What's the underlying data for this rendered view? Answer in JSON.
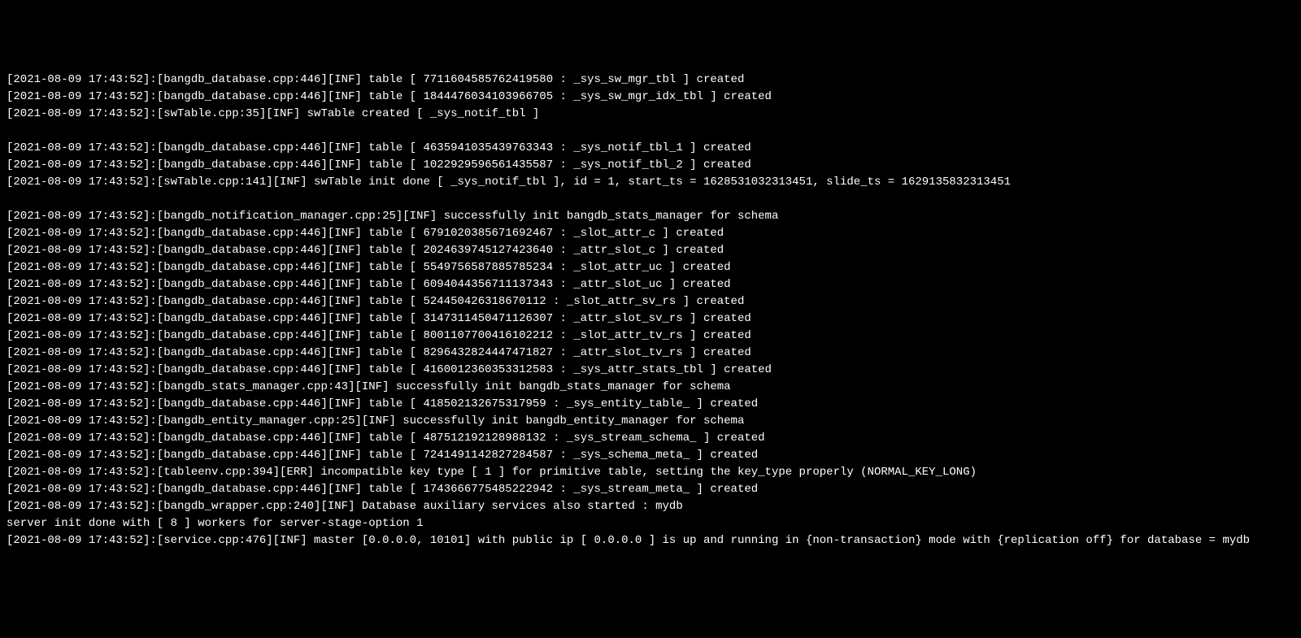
{
  "log_lines": [
    "[2021-08-09 17:43:52]:[bangdb_database.cpp:446][INF] table [ 7711604585762419580 : _sys_sw_mgr_tbl ] created",
    "[2021-08-09 17:43:52]:[bangdb_database.cpp:446][INF] table [ 1844476034103966705 : _sys_sw_mgr_idx_tbl ] created",
    "[2021-08-09 17:43:52]:[swTable.cpp:35][INF] swTable created [ _sys_notif_tbl ]",
    "",
    "[2021-08-09 17:43:52]:[bangdb_database.cpp:446][INF] table [ 4635941035439763343 : _sys_notif_tbl_1 ] created",
    "[2021-08-09 17:43:52]:[bangdb_database.cpp:446][INF] table [ 1022929596561435587 : _sys_notif_tbl_2 ] created",
    "[2021-08-09 17:43:52]:[swTable.cpp:141][INF] swTable init done [ _sys_notif_tbl ], id = 1, start_ts = 1628531032313451, slide_ts = 1629135832313451",
    "",
    "[2021-08-09 17:43:52]:[bangdb_notification_manager.cpp:25][INF] successfully init bangdb_stats_manager for schema",
    "[2021-08-09 17:43:52]:[bangdb_database.cpp:446][INF] table [ 6791020385671692467 : _slot_attr_c ] created",
    "[2021-08-09 17:43:52]:[bangdb_database.cpp:446][INF] table [ 2024639745127423640 : _attr_slot_c ] created",
    "[2021-08-09 17:43:52]:[bangdb_database.cpp:446][INF] table [ 5549756587885785234 : _slot_attr_uc ] created",
    "[2021-08-09 17:43:52]:[bangdb_database.cpp:446][INF] table [ 6094044356711137343 : _attr_slot_uc ] created",
    "[2021-08-09 17:43:52]:[bangdb_database.cpp:446][INF] table [ 524450426318670112 : _slot_attr_sv_rs ] created",
    "[2021-08-09 17:43:52]:[bangdb_database.cpp:446][INF] table [ 3147311450471126307 : _attr_slot_sv_rs ] created",
    "[2021-08-09 17:43:52]:[bangdb_database.cpp:446][INF] table [ 8001107700416102212 : _slot_attr_tv_rs ] created",
    "[2021-08-09 17:43:52]:[bangdb_database.cpp:446][INF] table [ 8296432824447471827 : _attr_slot_tv_rs ] created",
    "[2021-08-09 17:43:52]:[bangdb_database.cpp:446][INF] table [ 4160012360353312583 : _sys_attr_stats_tbl ] created",
    "[2021-08-09 17:43:52]:[bangdb_stats_manager.cpp:43][INF] successfully init bangdb_stats_manager for schema",
    "[2021-08-09 17:43:52]:[bangdb_database.cpp:446][INF] table [ 418502132675317959 : _sys_entity_table_ ] created",
    "[2021-08-09 17:43:52]:[bangdb_entity_manager.cpp:25][INF] successfully init bangdb_entity_manager for schema",
    "[2021-08-09 17:43:52]:[bangdb_database.cpp:446][INF] table [ 487512192128988132 : _sys_stream_schema_ ] created",
    "[2021-08-09 17:43:52]:[bangdb_database.cpp:446][INF] table [ 7241491142827284587 : _sys_schema_meta_ ] created",
    "[2021-08-09 17:43:52]:[tableenv.cpp:394][ERR] incompatible key type [ 1 ] for primitive table, setting the key_type properly (NORMAL_KEY_LONG)",
    "[2021-08-09 17:43:52]:[bangdb_database.cpp:446][INF] table [ 1743666775485222942 : _sys_stream_meta_ ] created",
    "[2021-08-09 17:43:52]:[bangdb_wrapper.cpp:240][INF] Database auxiliary services also started : mydb",
    "server init done with [ 8 ] workers for server-stage-option 1",
    "[2021-08-09 17:43:52]:[service.cpp:476][INF] master [0.0.0.0, 10101] with public ip [ 0.0.0.0 ] is up and running in {non-transaction} mode with {replication off} for database = mydb"
  ]
}
